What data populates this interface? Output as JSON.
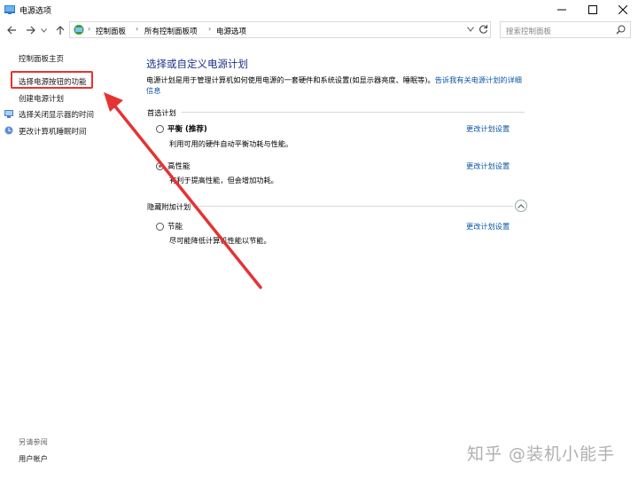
{
  "window": {
    "title": "电源选项"
  },
  "address": {
    "breadcrumbs": [
      "控制面板",
      "所有控制面板项",
      "电源选项"
    ],
    "search_placeholder": "搜索控制面板"
  },
  "sidebar": {
    "home": "控制面板主页",
    "items": [
      {
        "label": "选择电源按钮的功能"
      },
      {
        "label": "创建电源计划"
      },
      {
        "label": "选择关闭显示器的时间"
      },
      {
        "label": "更改计算机睡眠时间"
      }
    ],
    "see_also": "另请参阅",
    "user_accounts": "用户帐户"
  },
  "main": {
    "title": "选择或自定义电源计划",
    "desc_prefix": "电源计划是用于管理计算机如何使用电源的一套硬件和系统设置(如显示器亮度、睡眠等)。",
    "desc_link": "告诉我有关电源计划的详细信息",
    "preferred_label": "首选计划",
    "hidden_label": "隐藏附加计划",
    "plans": [
      {
        "name": "平衡 (推荐)",
        "desc": "利用可用的硬件自动平衡功耗与性能。",
        "link": "更改计划设置",
        "selected": false
      },
      {
        "name": "高性能",
        "desc": "有利于提高性能，但会增加功耗。",
        "link": "更改计划设置",
        "selected": true
      },
      {
        "name": "节能",
        "desc": "尽可能降低计算机性能以节能。",
        "link": "更改计划设置",
        "selected": false
      }
    ]
  },
  "watermark": "知乎 @装机小能手",
  "colors": {
    "annotation_red": "#e53333",
    "link_blue": "#0b57a4",
    "title_blue": "#1e3287"
  },
  "icons": [
    "control-panel-icon",
    "back-icon",
    "forward-icon",
    "up-icon",
    "refresh-icon",
    "search-icon",
    "minimize-icon",
    "maximize-icon",
    "close-icon",
    "shield-icon",
    "chevron-up-icon"
  ]
}
